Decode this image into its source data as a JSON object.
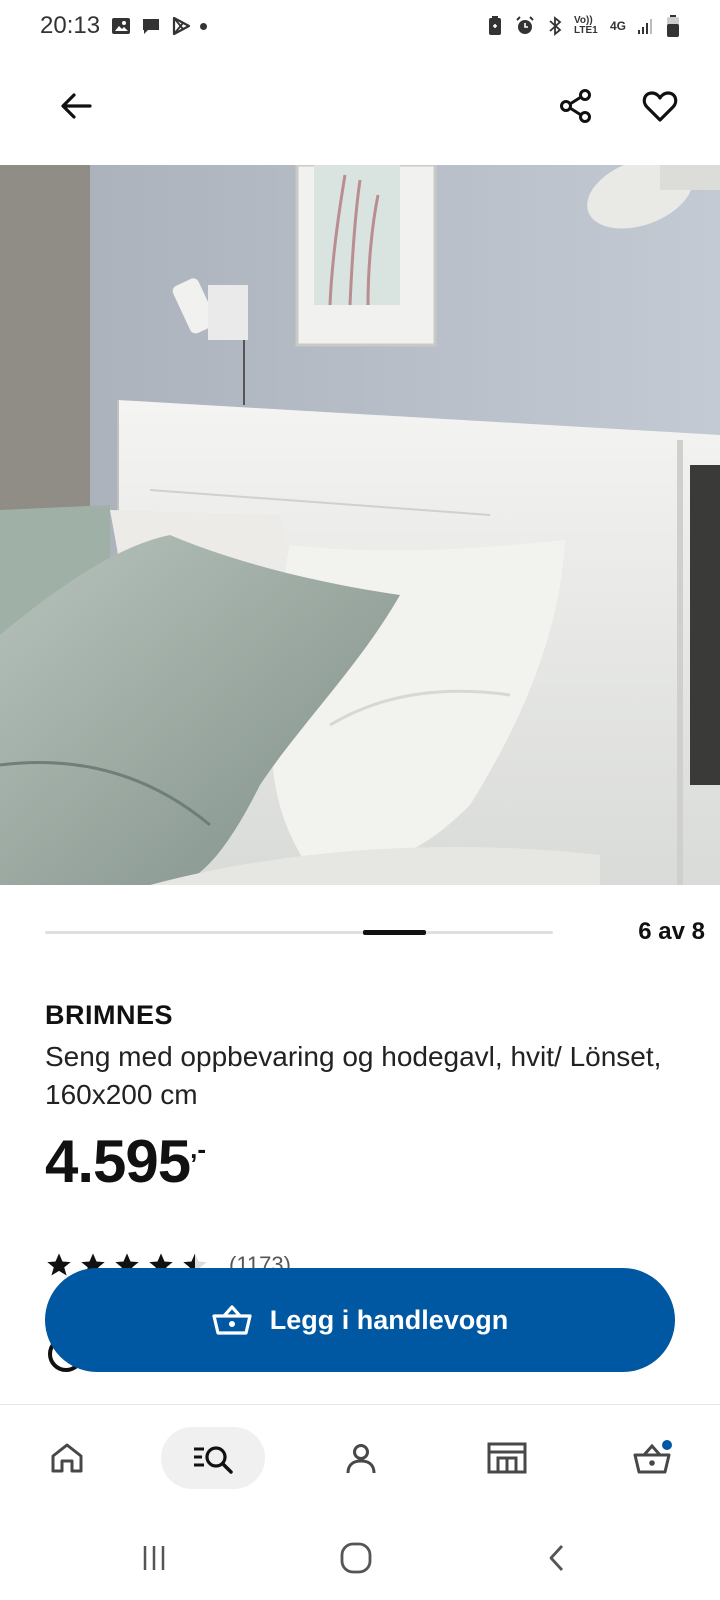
{
  "status_bar": {
    "time": "20:13",
    "left_icons": [
      "gallery-icon",
      "message-icon",
      "play-store-icon",
      "dot-icon"
    ],
    "right_icons": [
      "battery-saver-icon",
      "alarm-icon",
      "bluetooth-icon",
      "volte-icon",
      "4g-icon",
      "signal-icon",
      "battery-icon"
    ],
    "volte_label": "Vo)) LTE1",
    "network_label": "4G"
  },
  "app_bar": {
    "back_icon": "arrow-left-icon",
    "share_icon": "share-icon",
    "favorite_icon": "heart-icon"
  },
  "gallery": {
    "current": 6,
    "total": 8,
    "counter_text": "6 av 8"
  },
  "product": {
    "name": "BRIMNES",
    "description": "Seng med oppbevaring og hodegavl, hvit/ Lönset, 160x200 cm",
    "price": "4.595",
    "price_suffix": ",-",
    "rating_value": 4.5,
    "rating_max": 5,
    "rating_count": "(1173)"
  },
  "cart_button": {
    "label": "Legg i handlevogn",
    "icon": "basket-icon",
    "color": "#0058a3"
  },
  "bottom_nav": {
    "items": [
      {
        "icon": "home-icon",
        "active": false
      },
      {
        "icon": "search-icon",
        "active": true
      },
      {
        "icon": "profile-icon",
        "active": false
      },
      {
        "icon": "store-icon",
        "active": false
      },
      {
        "icon": "cart-icon",
        "active": false,
        "badge_color": "#0058a3"
      }
    ]
  },
  "system_nav": {
    "items": [
      "recents-icon",
      "home-circle-icon",
      "back-chevron-icon"
    ]
  }
}
